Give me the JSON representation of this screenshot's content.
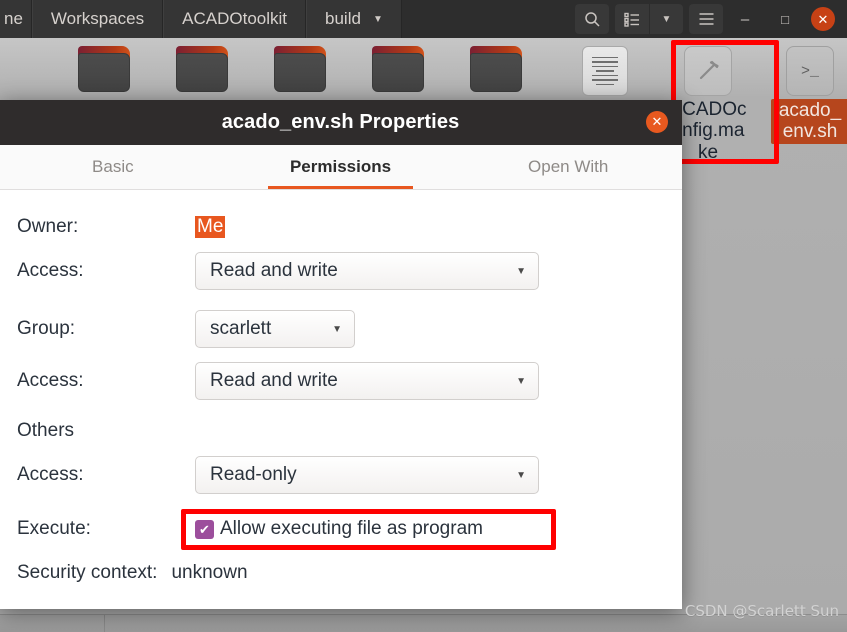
{
  "file_manager": {
    "pathbar": [
      {
        "label": "ne",
        "icon": "folder-icon",
        "truncated": true
      },
      {
        "label": "Workspaces",
        "icon": "folder-icon"
      },
      {
        "label": "ACADOtoolkit",
        "icon": "folder-icon"
      },
      {
        "label": "build",
        "icon": "chevron-down-icon",
        "has_caret": true
      }
    ],
    "toolbar": {
      "search": "search-icon",
      "list_view": "list-view-icon",
      "view_dropdown": "chevron-down-icon",
      "menu": "hamburger-menu-icon",
      "minimize": "minimize-icon",
      "maximize": "maximize-icon",
      "close": "close-icon",
      "minimize_label": "–",
      "maximize_label": "□",
      "close_label": "✕"
    },
    "files_left": [
      {
        "label": "",
        "icon": "folder-icon"
      },
      {
        "label": "",
        "icon": "folder-icon"
      },
      {
        "label": "",
        "icon": "folder-icon"
      },
      {
        "label": "",
        "icon": "folder-icon"
      },
      {
        "label": "",
        "icon": "folder-icon"
      },
      {
        "label": "",
        "icon": "text-document-icon"
      }
    ],
    "files_right": [
      {
        "label": "ACADOconfig.make",
        "icon": "build-tool-icon",
        "selected": false
      },
      {
        "label": "acado_env.sh",
        "icon": "terminal-script-icon",
        "selected": true
      }
    ]
  },
  "dialog": {
    "title": "acado_env.sh Properties",
    "close_label": "✕",
    "tabs": [
      {
        "label": "Basic",
        "active": false
      },
      {
        "label": "Permissions",
        "active": true
      },
      {
        "label": "Open With",
        "active": false
      }
    ],
    "owner": {
      "label": "Owner:",
      "value": "Me",
      "access_label": "Access:",
      "access_value": "Read and write"
    },
    "group": {
      "label": "Group:",
      "value": "scarlett",
      "access_label": "Access:",
      "access_value": "Read and write"
    },
    "others": {
      "label": "Others",
      "access_label": "Access:",
      "access_value": "Read-only"
    },
    "execute": {
      "label": "Execute:",
      "checkbox_label": "Allow executing file as program",
      "checked": true,
      "check_glyph": "✔"
    },
    "security": {
      "label": "Security context:",
      "value": "unknown"
    }
  },
  "annotations": {
    "highlight_color": "#ff0000",
    "accent_color": "#e8571f",
    "checkbox_color": "#9c4e9c"
  },
  "watermark": {
    "text": "CSDN @Scarlett Sun"
  }
}
